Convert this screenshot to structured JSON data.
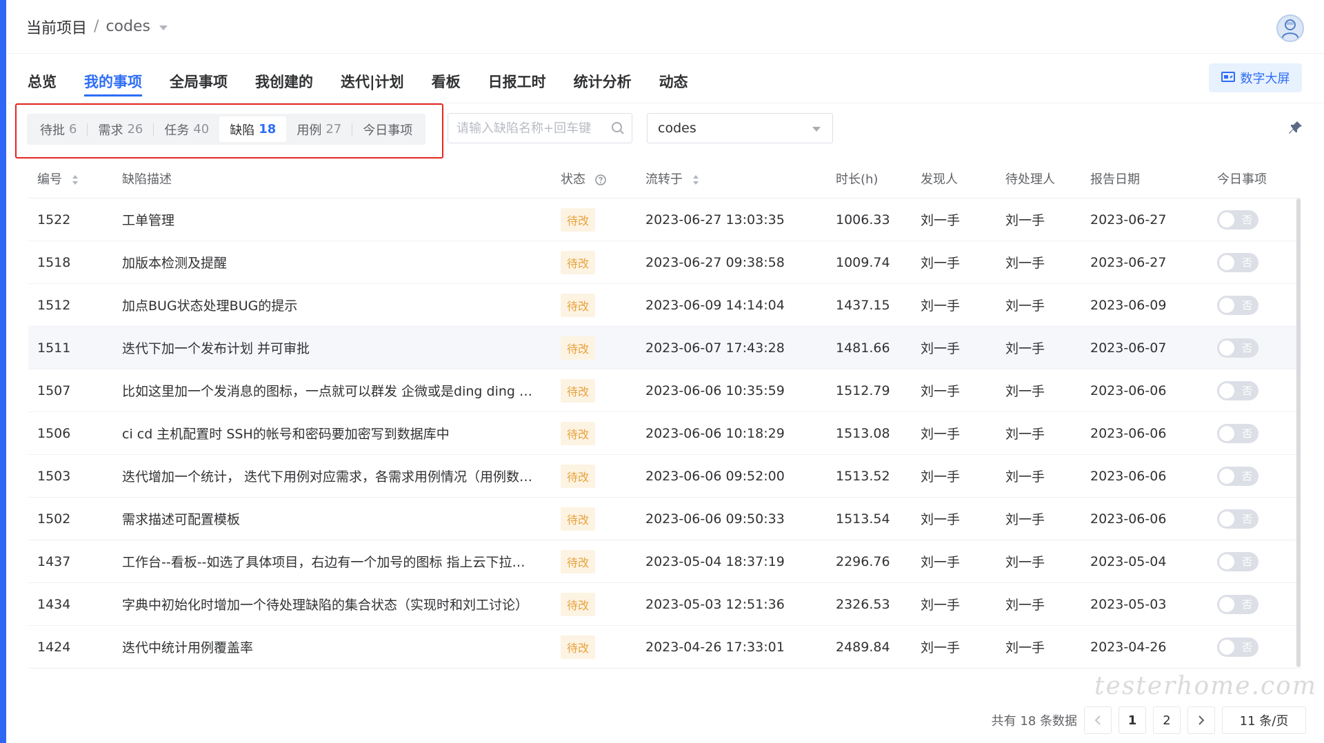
{
  "header": {
    "breadcrumb_prefix": "当前项目",
    "breadcrumb_sep": "/",
    "project": "codes"
  },
  "nav": {
    "tabs": [
      {
        "label": "总览"
      },
      {
        "label": "我的事项",
        "active": true
      },
      {
        "label": "全局事项"
      },
      {
        "label": "我创建的"
      },
      {
        "label": "迭代|计划"
      },
      {
        "label": "看板"
      },
      {
        "label": "日报工时"
      },
      {
        "label": "统计分析"
      },
      {
        "label": "动态"
      }
    ],
    "bigscreen_label": "数字大屏"
  },
  "filter": {
    "segments": [
      {
        "label": "待批",
        "count": "6"
      },
      {
        "label": "需求",
        "count": "26"
      },
      {
        "label": "任务",
        "count": "40"
      },
      {
        "label": "缺陷",
        "count": "18",
        "active": true
      },
      {
        "label": "用例",
        "count": "27"
      },
      {
        "label": "今日事项",
        "count": ""
      }
    ],
    "search_placeholder": "请输入缺陷名称+回车键",
    "project_select": "codes"
  },
  "table": {
    "columns": {
      "id": "编号",
      "desc": "缺陷描述",
      "status": "状态",
      "flow": "流转于",
      "duration": "时长(h)",
      "finder": "发现人",
      "handler": "待处理人",
      "report_date": "报告日期",
      "today": "今日事项"
    },
    "rows": [
      {
        "id": "1522",
        "desc": "工单管理",
        "status": "待改",
        "flow": "2023-06-27 13:03:35",
        "duration": "1006.33",
        "finder": "刘一手",
        "handler": "刘一手",
        "date": "2023-06-27",
        "today": "否"
      },
      {
        "id": "1518",
        "desc": "加版本检测及提醒",
        "status": "待改",
        "flow": "2023-06-27 09:38:58",
        "duration": "1009.74",
        "finder": "刘一手",
        "handler": "刘一手",
        "date": "2023-06-27",
        "today": "否"
      },
      {
        "id": "1512",
        "desc": "加点BUG状态处理BUG的提示",
        "status": "待改",
        "flow": "2023-06-09 14:14:04",
        "duration": "1437.15",
        "finder": "刘一手",
        "handler": "刘一手",
        "date": "2023-06-09",
        "today": "否"
      },
      {
        "id": "1511",
        "desc": "迭代下加一个发布计划 并可审批",
        "status": "待改",
        "flow": "2023-06-07 17:43:28",
        "duration": "1481.66",
        "finder": "刘一手",
        "handler": "刘一手",
        "date": "2023-06-07",
        "today": "否"
      },
      {
        "id": "1507",
        "desc": "比如这里加一个发消息的图标，一点就可以群发 企微或是ding ding 中 ...",
        "status": "待改",
        "flow": "2023-06-06 10:35:59",
        "duration": "1512.79",
        "finder": "刘一手",
        "handler": "刘一手",
        "date": "2023-06-06",
        "today": "否"
      },
      {
        "id": "1506",
        "desc": "ci cd 主机配置时 SSH的帐号和密码要加密写到数据库中",
        "status": "待改",
        "flow": "2023-06-06 10:18:29",
        "duration": "1513.08",
        "finder": "刘一手",
        "handler": "刘一手",
        "date": "2023-06-06",
        "today": "否"
      },
      {
        "id": "1503",
        "desc": "迭代增加一个统计， 迭代下用例对应需求，各需求用例情况（用例数， ...",
        "status": "待改",
        "flow": "2023-06-06 09:52:00",
        "duration": "1513.52",
        "finder": "刘一手",
        "handler": "刘一手",
        "date": "2023-06-06",
        "today": "否"
      },
      {
        "id": "1502",
        "desc": "需求描述可配置模板",
        "status": "待改",
        "flow": "2023-06-06 09:50:33",
        "duration": "1513.54",
        "finder": "刘一手",
        "handler": "刘一手",
        "date": "2023-06-06",
        "today": "否"
      },
      {
        "id": "1437",
        "desc": "工作台--看板--如选了具体项目，右边有一个加号的图标 指上云下拉浮...",
        "status": "待改",
        "flow": "2023-05-04 18:37:19",
        "duration": "2296.76",
        "finder": "刘一手",
        "handler": "刘一手",
        "date": "2023-05-04",
        "today": "否"
      },
      {
        "id": "1434",
        "desc": "字典中初始化时增加一个待处理缺陷的集合状态（实现时和刘工讨论）",
        "status": "待改",
        "flow": "2023-05-03 12:51:36",
        "duration": "2326.53",
        "finder": "刘一手",
        "handler": "刘一手",
        "date": "2023-05-03",
        "today": "否"
      },
      {
        "id": "1424",
        "desc": "迭代中统计用例覆盖率",
        "status": "待改",
        "flow": "2023-04-26 17:33:01",
        "duration": "2489.84",
        "finder": "刘一手",
        "handler": "刘一手",
        "date": "2023-04-26",
        "today": "否"
      }
    ]
  },
  "pagination": {
    "total_text": "共有 18 条数据",
    "pages": [
      "1",
      "2"
    ],
    "current": "1",
    "page_size_text": "11 条/页"
  },
  "watermark": "testerhome.com",
  "colors": {
    "primary": "#2d6df6",
    "status_pending": "#e6a23c",
    "highlight": "#e3251f"
  }
}
